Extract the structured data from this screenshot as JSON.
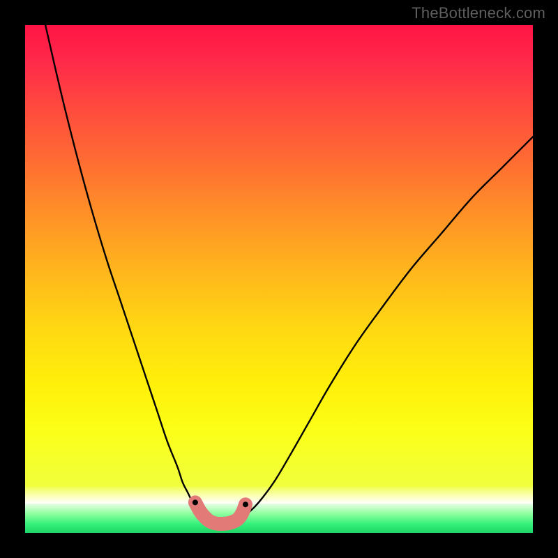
{
  "watermark": "TheBottleneck.com",
  "colors": {
    "curve": "#000000",
    "highlight": "#e27a78",
    "frame": "#000000"
  },
  "chart_data": {
    "type": "line",
    "title": "",
    "xlabel": "",
    "ylabel": "",
    "xlim": [
      0,
      100
    ],
    "ylim": [
      0,
      100
    ],
    "series": [
      {
        "name": "left-curve",
        "x": [
          4,
          7,
          10,
          13,
          16,
          19,
          22,
          24,
          26,
          28,
          30,
          31,
          32,
          33,
          34,
          35,
          36
        ],
        "y": [
          100,
          87,
          75,
          64,
          54,
          45,
          36,
          30,
          24,
          18,
          13,
          10,
          8,
          6,
          4.5,
          3.2,
          2.3
        ]
      },
      {
        "name": "right-curve",
        "x": [
          42,
          44,
          46,
          49,
          52,
          56,
          60,
          65,
          70,
          76,
          82,
          88,
          94,
          100
        ],
        "y": [
          2.5,
          4,
          6,
          10,
          15,
          22,
          29,
          37,
          44,
          52,
          59,
          66,
          72,
          78
        ]
      },
      {
        "name": "bottom-band",
        "x": [
          33.5,
          34.5,
          35.5,
          36.2,
          37,
          38,
          39,
          40,
          41,
          42,
          42.8,
          43.4
        ],
        "y": [
          6,
          4.2,
          3,
          2.4,
          2,
          1.8,
          1.8,
          1.9,
          2.2,
          2.8,
          4,
          5.6
        ]
      }
    ],
    "annotations": []
  }
}
